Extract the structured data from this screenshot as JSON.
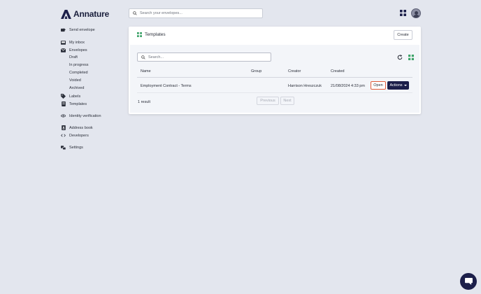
{
  "brand": {
    "name": "Annature",
    "color": "#1c1f4a"
  },
  "header": {
    "search_placeholder": "Search your envelopes...",
    "grid_icon": "grid-icon",
    "avatar_icon": "user-avatar"
  },
  "sidebar": {
    "send_envelope": "Send envelope",
    "my_inbox": "My inbox",
    "envelopes": "Envelopes",
    "envelope_subitems": [
      "Draft",
      "In progress",
      "Completed",
      "Voided",
      "Archived"
    ],
    "labels": "Labels",
    "templates": "Templates",
    "identity_verification": "Identity verification",
    "address_book": "Address book",
    "developers": "Developers",
    "settings": "Settings"
  },
  "panel": {
    "title": "Templates",
    "create_label": "Create",
    "search_placeholder": "Search...",
    "columns": [
      "Name",
      "Group",
      "Creator",
      "Created"
    ],
    "rows": [
      {
        "name": "Employment Contract - Terms",
        "group": "",
        "creator": "Harrison Hreszczuk",
        "created": "21/08/2024 4:33 pm"
      }
    ],
    "open_label": "Open",
    "actions_label": "Actions",
    "result_count": "1 result",
    "previous_label": "Previous",
    "next_label": "Next"
  },
  "colors": {
    "accent": "#1c1f4a",
    "template_icon": "#3fa46a",
    "open_border": "#e05a3a",
    "background": "#e3e6ee"
  }
}
